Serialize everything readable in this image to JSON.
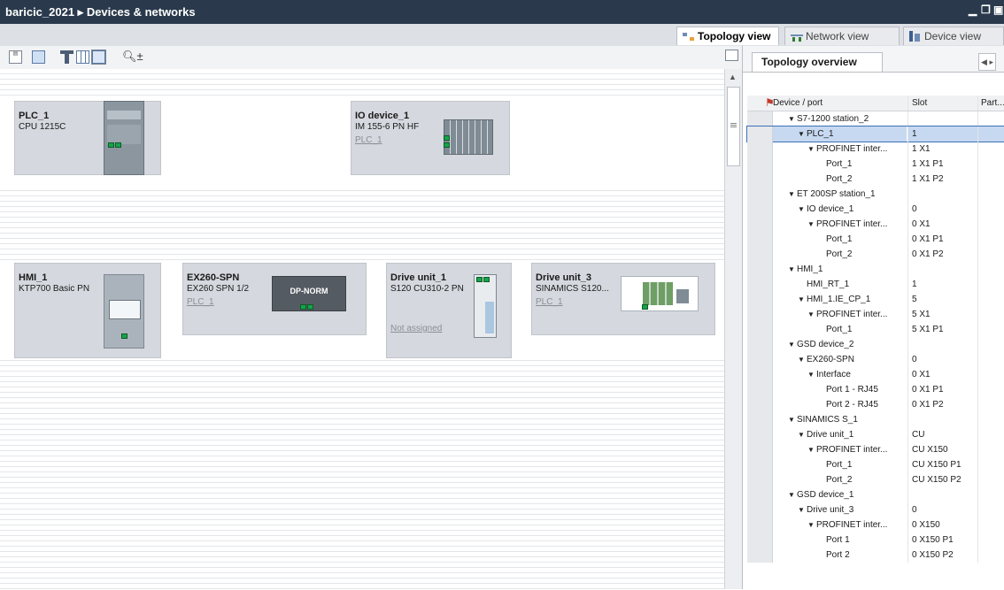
{
  "window": {
    "title": "baricic_2021 ▸ Devices & networks"
  },
  "view_tabs": [
    {
      "label": "Topology view",
      "active": true
    },
    {
      "label": "Network view",
      "active": false
    },
    {
      "label": "Device view",
      "active": false
    }
  ],
  "toolbar": {
    "icons": [
      "topology-text-icon",
      "connect-icon",
      "rack-icon",
      "grid-icon",
      "table-icon",
      "zoom-icon"
    ]
  },
  "devices": [
    {
      "name": "PLC_1",
      "sub": "CPU 1215C",
      "link": ""
    },
    {
      "name": "IO device_1",
      "sub": "IM 155-6 PN HF",
      "link": "PLC_1"
    },
    {
      "name": "HMI_1",
      "sub": "KTP700 Basic PN",
      "link": ""
    },
    {
      "name": "EX260-SPN",
      "sub": "EX260 SPN 1/2",
      "link": "PLC_1",
      "badge": "DP-NORM"
    },
    {
      "name": "Drive unit_1",
      "sub": "S120 CU310-2 PN",
      "link": "Not assigned"
    },
    {
      "name": "Drive unit_3",
      "sub": "SINAMICS S120...",
      "link": "PLC_1"
    }
  ],
  "panel": {
    "tab_label": "Topology overview",
    "nav_label": "◀ ▸",
    "columns": [
      "Device / port",
      "Slot",
      "Part..."
    ],
    "rows": [
      {
        "indent": 1,
        "tri": "▼",
        "name": "S7-1200 station_2",
        "slot": ""
      },
      {
        "indent": 2,
        "tri": "▼",
        "name": "PLC_1",
        "slot": "1",
        "selected": true
      },
      {
        "indent": 3,
        "tri": "▼",
        "name": "PROFINET inter...",
        "slot": "1 X1"
      },
      {
        "indent": 4,
        "tri": "",
        "name": "Port_1",
        "slot": "1 X1 P1"
      },
      {
        "indent": 4,
        "tri": "",
        "name": "Port_2",
        "slot": "1 X1 P2"
      },
      {
        "indent": 1,
        "tri": "▼",
        "name": "ET 200SP station_1",
        "slot": ""
      },
      {
        "indent": 2,
        "tri": "▼",
        "name": "IO device_1",
        "slot": "0"
      },
      {
        "indent": 3,
        "tri": "▼",
        "name": "PROFINET inter...",
        "slot": "0 X1"
      },
      {
        "indent": 4,
        "tri": "",
        "name": "Port_1",
        "slot": "0 X1 P1"
      },
      {
        "indent": 4,
        "tri": "",
        "name": "Port_2",
        "slot": "0 X1 P2"
      },
      {
        "indent": 1,
        "tri": "▼",
        "name": "HMI_1",
        "slot": ""
      },
      {
        "indent": 2,
        "tri": "",
        "name": "HMI_RT_1",
        "slot": "1"
      },
      {
        "indent": 2,
        "tri": "▼",
        "name": "HMI_1.IE_CP_1",
        "slot": "5"
      },
      {
        "indent": 3,
        "tri": "▼",
        "name": "PROFINET inter...",
        "slot": "5 X1"
      },
      {
        "indent": 4,
        "tri": "",
        "name": "Port_1",
        "slot": "5 X1 P1"
      },
      {
        "indent": 1,
        "tri": "▼",
        "name": "GSD device_2",
        "slot": ""
      },
      {
        "indent": 2,
        "tri": "▼",
        "name": "EX260-SPN",
        "slot": "0"
      },
      {
        "indent": 3,
        "tri": "▼",
        "name": "Interface",
        "slot": "0 X1"
      },
      {
        "indent": 4,
        "tri": "",
        "name": "Port 1 - RJ45",
        "slot": "0 X1 P1"
      },
      {
        "indent": 4,
        "tri": "",
        "name": "Port 2 - RJ45",
        "slot": "0 X1 P2"
      },
      {
        "indent": 1,
        "tri": "▼",
        "name": "SINAMICS S_1",
        "slot": ""
      },
      {
        "indent": 2,
        "tri": "▼",
        "name": "Drive unit_1",
        "slot": "CU"
      },
      {
        "indent": 3,
        "tri": "▼",
        "name": "PROFINET inter...",
        "slot": "CU X150"
      },
      {
        "indent": 4,
        "tri": "",
        "name": "Port_1",
        "slot": "CU X150 P1"
      },
      {
        "indent": 4,
        "tri": "",
        "name": "Port_2",
        "slot": "CU X150 P2"
      },
      {
        "indent": 1,
        "tri": "▼",
        "name": "GSD device_1",
        "slot": ""
      },
      {
        "indent": 2,
        "tri": "▼",
        "name": "Drive unit_3",
        "slot": "0"
      },
      {
        "indent": 3,
        "tri": "▼",
        "name": "PROFINET inter...",
        "slot": "0 X150"
      },
      {
        "indent": 4,
        "tri": "",
        "name": "Port 1",
        "slot": "0 X150 P1"
      },
      {
        "indent": 4,
        "tri": "",
        "name": "Port 2",
        "slot": "0 X150 P2"
      }
    ]
  },
  "colors": {
    "titlebar": "#2a3a4c",
    "device_box": "#d5d8de",
    "port_green": "#16a34a",
    "selection": "#c6d9f0"
  }
}
